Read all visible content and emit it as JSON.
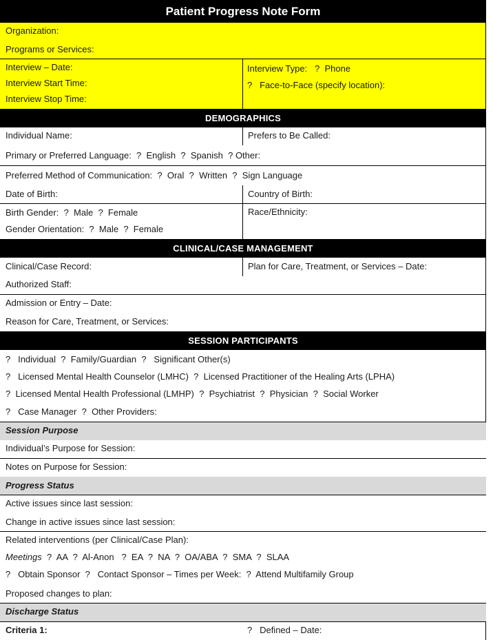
{
  "title": "Patient Progress Note Form",
  "colors": {
    "header_bg": "#000000",
    "yellow": "#ffff00",
    "gray_section": "#d9d9d9"
  },
  "checkbox_glyph": "?",
  "top": {
    "organization": "Organization:",
    "programs": "Programs or Services:",
    "interview_date": "Interview – Date:",
    "interview_start": "Interview Start Time:",
    "interview_stop": "Interview Stop Time:",
    "interview_type": "Interview Type:",
    "phone": "Phone",
    "face_to_face": "Face-to-Face (specify location):"
  },
  "demographics": {
    "header": "DEMOGRAPHICS",
    "individual_name": "Individual Name:",
    "prefers_called": "Prefers to Be Called:",
    "language_label": "Primary or Preferred Language:",
    "lang_english": "English",
    "lang_spanish": "Spanish",
    "lang_other": "Other:",
    "comm_label": "Preferred Method of Communication:",
    "comm_oral": "Oral",
    "comm_written": "Written",
    "comm_sign": "Sign Language",
    "dob": "Date of Birth:",
    "country_birth": "Country of Birth:",
    "birth_gender": "Birth Gender:",
    "male": "Male",
    "female": "Female",
    "gender_orientation": "Gender Orientation:",
    "race": "Race/Ethnicity:"
  },
  "clinical": {
    "header": "CLINICAL/CASE MANAGEMENT",
    "record": "Clinical/Case Record:",
    "plan_date": "Plan for Care, Treatment, or Services – Date:",
    "authorized_staff": "Authorized Staff:",
    "admission_date": "Admission or Entry – Date:",
    "reason": "Reason for Care, Treatment, or Services:"
  },
  "participants": {
    "header": "SESSION PARTICIPANTS",
    "individual": "Individual",
    "family": "Family/Guardian",
    "significant": "Significant Other(s)",
    "lmhc": "Licensed Mental Health Counselor (LMHC)",
    "lpha": "Licensed Practitioner of the Healing Arts (LPHA)",
    "lmhp": "Licensed Mental Health Professional (LMHP)",
    "psychiatrist": "Psychiatrist",
    "physician": "Physician",
    "social_worker": "Social Worker",
    "case_manager": "Case Manager",
    "other_providers": "Other Providers:"
  },
  "session_purpose": {
    "header": "Session Purpose",
    "individual_purpose": "Individual’s Purpose for Session:",
    "notes": "Notes on Purpose for Session:"
  },
  "progress": {
    "header": "Progress Status",
    "active_issues": "Active issues since last session:",
    "change_issues": "Change in active issues since last session:",
    "related": "Related interventions (per Clinical/Case Plan):",
    "meetings": "Meetings",
    "meeting_options": [
      "AA",
      "Al-Anon",
      "EA",
      "NA",
      "OA/ABA",
      "SMA",
      "SLAA"
    ],
    "obtain_sponsor": "Obtain Sponsor",
    "contact_sponsor": "Contact Sponsor – Times per Week:",
    "multifamily": "Attend Multifamily Group",
    "proposed": "Proposed changes to plan:"
  },
  "discharge": {
    "header": "Discharge Status",
    "criteria1": "Criteria 1:",
    "defined_date": "Defined – Date:"
  }
}
